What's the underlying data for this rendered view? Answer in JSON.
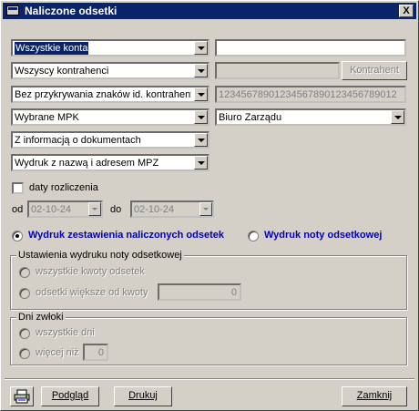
{
  "window": {
    "title": "Naliczone odsetki",
    "close_label": "X"
  },
  "filters": {
    "accounts": "Wszystkie konta",
    "contractors": "Wszyscy kontrahenci",
    "masking": "Bez przykrywania znaków id. kontrahenta",
    "mpk": "Wybrane MPK",
    "doc_info": "Z informacją o dokumentach",
    "print_mode": "Wydruk z nazwą i adresem MPZ",
    "contractor_button": "Kontrahent",
    "id_mask_value": "12345678901234567890123456789012",
    "mpk_value": "Biuro Zarządu"
  },
  "settlement": {
    "checkbox_label": "daty rozliczenia",
    "from_label": "od",
    "from_value": "02-10-24",
    "to_label": "do",
    "to_value": "02-10-24"
  },
  "print_type": {
    "option1": "Wydruk zestawienia naliczonych odsetek",
    "option2": "Wydruk noty odsetkowej"
  },
  "note_settings": {
    "title": "Ustawienia  wydruku noty odsetkowej",
    "all_amounts": "wszystkie kwoty odsetek",
    "greater_than": "odsetki większe od kwoty",
    "amount_value": "0"
  },
  "delay_days": {
    "title": "Dni zwłoki",
    "all_days": "wszystkie dni",
    "more_than": "więcej niż",
    "days_value": "0"
  },
  "footer": {
    "preview": "Podgląd",
    "print": "Drukuj",
    "close": "Zamknij"
  }
}
